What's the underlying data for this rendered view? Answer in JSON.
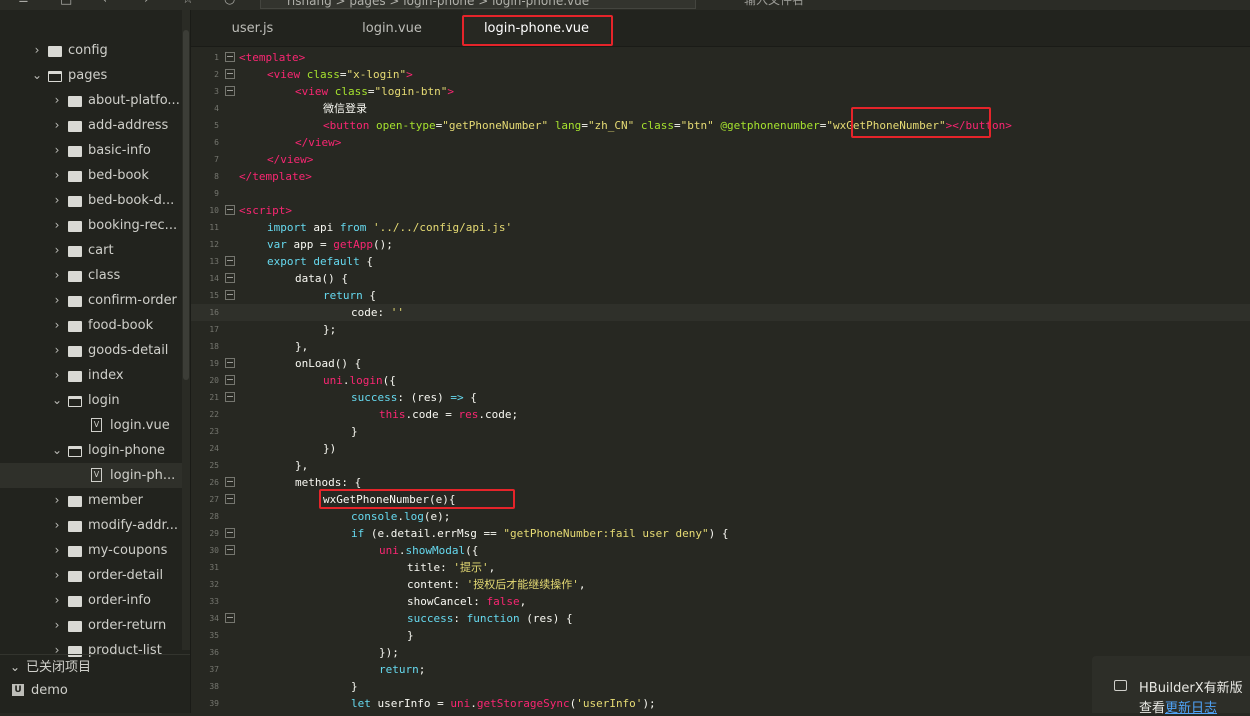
{
  "colors": {
    "tag": "#f92672",
    "attr": "#a6e22e",
    "string": "#e6db74",
    "plain": "#f8f8f2",
    "keyword": "#66d9ef",
    "call": "#f92672",
    "highlight_box": "#e5242a",
    "link": "#4fa3f7"
  },
  "topbar": {
    "breadcrumb": "rishang  >  pages  >  login-phone  >  login-phone.vue",
    "search_placeholder": "输入文件名"
  },
  "sidebar": {
    "tree": [
      {
        "label": "config",
        "depth": 0,
        "kind": "folder",
        "open": false
      },
      {
        "label": "pages",
        "depth": 0,
        "kind": "folder",
        "open": true
      },
      {
        "label": "about-platfo...",
        "depth": 1,
        "kind": "folder",
        "open": false
      },
      {
        "label": "add-address",
        "depth": 1,
        "kind": "folder",
        "open": false
      },
      {
        "label": "basic-info",
        "depth": 1,
        "kind": "folder",
        "open": false
      },
      {
        "label": "bed-book",
        "depth": 1,
        "kind": "folder",
        "open": false
      },
      {
        "label": "bed-book-d...",
        "depth": 1,
        "kind": "folder",
        "open": false
      },
      {
        "label": "booking-rec...",
        "depth": 1,
        "kind": "folder",
        "open": false
      },
      {
        "label": "cart",
        "depth": 1,
        "kind": "folder",
        "open": false
      },
      {
        "label": "class",
        "depth": 1,
        "kind": "folder",
        "open": false
      },
      {
        "label": "confirm-order",
        "depth": 1,
        "kind": "folder",
        "open": false
      },
      {
        "label": "food-book",
        "depth": 1,
        "kind": "folder",
        "open": false
      },
      {
        "label": "goods-detail",
        "depth": 1,
        "kind": "folder",
        "open": false
      },
      {
        "label": "index",
        "depth": 1,
        "kind": "folder",
        "open": false
      },
      {
        "label": "login",
        "depth": 1,
        "kind": "folder",
        "open": true
      },
      {
        "label": "login.vue",
        "depth": 2,
        "kind": "file"
      },
      {
        "label": "login-phone",
        "depth": 1,
        "kind": "folder",
        "open": true
      },
      {
        "label": "login-ph...",
        "depth": 2,
        "kind": "file",
        "selected": true
      },
      {
        "label": "member",
        "depth": 1,
        "kind": "folder",
        "open": false
      },
      {
        "label": "modify-addr...",
        "depth": 1,
        "kind": "folder",
        "open": false
      },
      {
        "label": "my-coupons",
        "depth": 1,
        "kind": "folder",
        "open": false
      },
      {
        "label": "order-detail",
        "depth": 1,
        "kind": "folder",
        "open": false
      },
      {
        "label": "order-info",
        "depth": 1,
        "kind": "folder",
        "open": false
      },
      {
        "label": "order-return",
        "depth": 1,
        "kind": "folder",
        "open": false
      },
      {
        "label": "product-list",
        "depth": 1,
        "kind": "folder",
        "open": false
      }
    ],
    "closed_projects_label": "已关闭项目",
    "demo_label": "demo"
  },
  "tabs": [
    {
      "label": "user.js",
      "active": false
    },
    {
      "label": "login.vue",
      "active": false
    },
    {
      "label": "login-phone.vue",
      "active": true
    }
  ],
  "editor": {
    "lines": [
      {
        "n": "1",
        "fold": true,
        "indent": 0,
        "tokens": [
          [
            "t",
            "<template>"
          ]
        ]
      },
      {
        "n": "2",
        "fold": true,
        "indent": 1,
        "tokens": [
          [
            "t",
            "<view "
          ],
          [
            "a",
            "class"
          ],
          [
            "p",
            "="
          ],
          [
            "s",
            "\"x-login\""
          ],
          [
            "t",
            ">"
          ]
        ]
      },
      {
        "n": "3",
        "fold": true,
        "indent": 2,
        "tokens": [
          [
            "t",
            "<view "
          ],
          [
            "a",
            "class"
          ],
          [
            "p",
            "="
          ],
          [
            "s",
            "\"login-btn\""
          ],
          [
            "t",
            ">"
          ]
        ]
      },
      {
        "n": "4",
        "fold": false,
        "indent": 3,
        "tokens": [
          [
            "p",
            "微信登录"
          ]
        ]
      },
      {
        "n": "5",
        "fold": false,
        "indent": 3,
        "tokens": [
          [
            "t",
            "<button "
          ],
          [
            "a",
            "open-type"
          ],
          [
            "p",
            "="
          ],
          [
            "s",
            "\"getPhoneNumber\""
          ],
          [
            "p",
            " "
          ],
          [
            "a",
            "lang"
          ],
          [
            "p",
            "="
          ],
          [
            "s",
            "\"zh_CN\""
          ],
          [
            "p",
            " "
          ],
          [
            "a",
            "class"
          ],
          [
            "p",
            "="
          ],
          [
            "s",
            "\"btn\""
          ],
          [
            "p",
            " "
          ],
          [
            "a",
            "@getphonenumber"
          ],
          [
            "p",
            "="
          ],
          [
            "s",
            "\"wxGetPhoneNumber\""
          ],
          [
            "t",
            "></button>"
          ]
        ]
      },
      {
        "n": "6",
        "fold": false,
        "indent": 2,
        "tokens": [
          [
            "t",
            "</view>"
          ]
        ]
      },
      {
        "n": "7",
        "fold": false,
        "indent": 1,
        "tokens": [
          [
            "t",
            "</view>"
          ]
        ]
      },
      {
        "n": "8",
        "fold": false,
        "indent": 0,
        "tokens": [
          [
            "t",
            "</template>"
          ]
        ]
      },
      {
        "n": "9",
        "fold": false,
        "indent": 0,
        "tokens": []
      },
      {
        "n": "10",
        "fold": true,
        "indent": 0,
        "tokens": [
          [
            "t",
            "<script>"
          ]
        ]
      },
      {
        "n": "11",
        "fold": false,
        "indent": 1,
        "tokens": [
          [
            "k",
            "import"
          ],
          [
            "p",
            " api "
          ],
          [
            "k",
            "from"
          ],
          [
            "p",
            " "
          ],
          [
            "s",
            "'../../config/api.js'"
          ]
        ]
      },
      {
        "n": "12",
        "fold": false,
        "indent": 1,
        "tokens": [
          [
            "k",
            "var"
          ],
          [
            "p",
            " app = "
          ],
          [
            "c",
            "getApp"
          ],
          [
            "p",
            "();"
          ]
        ]
      },
      {
        "n": "13",
        "fold": true,
        "indent": 1,
        "tokens": [
          [
            "k",
            "export default"
          ],
          [
            "p",
            " {"
          ]
        ]
      },
      {
        "n": "14",
        "fold": true,
        "indent": 2,
        "tokens": [
          [
            "p",
            "data() {"
          ]
        ]
      },
      {
        "n": "15",
        "fold": true,
        "indent": 3,
        "tokens": [
          [
            "k",
            "return"
          ],
          [
            "p",
            " {"
          ]
        ]
      },
      {
        "n": "16",
        "fold": false,
        "indent": 4,
        "cur": true,
        "tokens": [
          [
            "p",
            "code: "
          ],
          [
            "s",
            "''"
          ]
        ]
      },
      {
        "n": "17",
        "fold": false,
        "indent": 3,
        "tokens": [
          [
            "p",
            "};"
          ]
        ]
      },
      {
        "n": "18",
        "fold": false,
        "indent": 2,
        "tokens": [
          [
            "p",
            "},"
          ]
        ]
      },
      {
        "n": "19",
        "fold": true,
        "indent": 2,
        "tokens": [
          [
            "p",
            "onLoad() {"
          ]
        ]
      },
      {
        "n": "20",
        "fold": true,
        "indent": 3,
        "tokens": [
          [
            "c",
            "uni"
          ],
          [
            "p",
            "."
          ],
          [
            "c",
            "login"
          ],
          [
            "p",
            "({"
          ]
        ]
      },
      {
        "n": "21",
        "fold": true,
        "indent": 4,
        "tokens": [
          [
            "k",
            "success"
          ],
          [
            "p",
            ": (res) "
          ],
          [
            "k",
            "=>"
          ],
          [
            "p",
            " {"
          ]
        ]
      },
      {
        "n": "22",
        "fold": false,
        "indent": 5,
        "tokens": [
          [
            "c",
            "this"
          ],
          [
            "p",
            ".code = "
          ],
          [
            "c",
            "res"
          ],
          [
            "p",
            ".code;"
          ]
        ]
      },
      {
        "n": "23",
        "fold": false,
        "indent": 4,
        "tokens": [
          [
            "p",
            "}"
          ]
        ]
      },
      {
        "n": "24",
        "fold": false,
        "indent": 3,
        "tokens": [
          [
            "p",
            "})"
          ]
        ]
      },
      {
        "n": "25",
        "fold": false,
        "indent": 2,
        "tokens": [
          [
            "p",
            "},"
          ]
        ]
      },
      {
        "n": "26",
        "fold": true,
        "indent": 2,
        "tokens": [
          [
            "p",
            "methods: {"
          ]
        ]
      },
      {
        "n": "27",
        "fold": true,
        "indent": 3,
        "tokens": [
          [
            "p",
            "wxGetPhoneNumber(e){"
          ]
        ]
      },
      {
        "n": "28",
        "fold": false,
        "indent": 4,
        "tokens": [
          [
            "k",
            "console"
          ],
          [
            "p",
            "."
          ],
          [
            "k",
            "log"
          ],
          [
            "p",
            "(e);"
          ]
        ]
      },
      {
        "n": "29",
        "fold": true,
        "indent": 4,
        "tokens": [
          [
            "k",
            "if"
          ],
          [
            "p",
            " (e.detail.errMsg == "
          ],
          [
            "s",
            "\"getPhoneNumber:fail user deny\""
          ],
          [
            "p",
            ") {"
          ]
        ]
      },
      {
        "n": "30",
        "fold": true,
        "indent": 5,
        "tokens": [
          [
            "c",
            "uni"
          ],
          [
            "p",
            "."
          ],
          [
            "k",
            "showModal"
          ],
          [
            "p",
            "({"
          ]
        ]
      },
      {
        "n": "31",
        "fold": false,
        "indent": 6,
        "tokens": [
          [
            "p",
            "title: "
          ],
          [
            "s",
            "'提示'"
          ],
          [
            "p",
            ","
          ]
        ]
      },
      {
        "n": "32",
        "fold": false,
        "indent": 6,
        "tokens": [
          [
            "p",
            "content: "
          ],
          [
            "s",
            "'授权后才能继续操作'"
          ],
          [
            "p",
            ","
          ]
        ]
      },
      {
        "n": "33",
        "fold": false,
        "indent": 6,
        "tokens": [
          [
            "p",
            "showCancel: "
          ],
          [
            "c",
            "false"
          ],
          [
            "p",
            ","
          ]
        ]
      },
      {
        "n": "34",
        "fold": true,
        "indent": 6,
        "tokens": [
          [
            "k",
            "success"
          ],
          [
            "p",
            ": "
          ],
          [
            "k",
            "function"
          ],
          [
            "p",
            " (res) {"
          ]
        ]
      },
      {
        "n": "35",
        "fold": false,
        "indent": 6,
        "tokens": [
          [
            "p",
            "}"
          ]
        ]
      },
      {
        "n": "36",
        "fold": false,
        "indent": 5,
        "tokens": [
          [
            "p",
            "});"
          ]
        ]
      },
      {
        "n": "37",
        "fold": false,
        "indent": 5,
        "tokens": [
          [
            "k",
            "return"
          ],
          [
            "p",
            ";"
          ]
        ]
      },
      {
        "n": "38",
        "fold": false,
        "indent": 4,
        "tokens": [
          [
            "p",
            "}"
          ]
        ]
      },
      {
        "n": "39",
        "fold": false,
        "indent": 4,
        "tokens": [
          [
            "k",
            "let"
          ],
          [
            "p",
            " userInfo = "
          ],
          [
            "c",
            "uni"
          ],
          [
            "p",
            "."
          ],
          [
            "c",
            "getStorageSync"
          ],
          [
            "p",
            "("
          ],
          [
            "s",
            "'userInfo'"
          ],
          [
            "p",
            ");"
          ]
        ]
      }
    ]
  },
  "notification": {
    "line1": "HBuilderX有新版",
    "line2_prefix": "查看",
    "line2_link": "更新日志"
  }
}
